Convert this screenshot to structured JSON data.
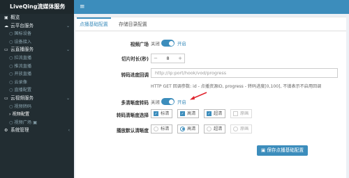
{
  "app": {
    "brand": "LiveQing流媒体服务"
  },
  "sidebar": {
    "items": [
      {
        "icon": "▣",
        "label": "概览",
        "type": "group"
      },
      {
        "icon": "☁",
        "label": "云平台服务",
        "type": "group",
        "caret": "⌄"
      },
      {
        "label": "国标设备",
        "type": "sub"
      },
      {
        "label": "设备接入",
        "type": "sub"
      },
      {
        "icon": "▭",
        "label": "云直播服务",
        "type": "group",
        "caret": "⌄"
      },
      {
        "label": "拉流直播",
        "type": "sub"
      },
      {
        "label": "推流直播",
        "type": "sub"
      },
      {
        "label": "开放直播",
        "type": "sub"
      },
      {
        "label": "云录像",
        "type": "sub"
      },
      {
        "label": "直播配置",
        "type": "sub"
      },
      {
        "icon": "▭",
        "label": "云视频服务",
        "type": "group",
        "caret": "⌄"
      },
      {
        "label": "视频转码",
        "type": "sub"
      },
      {
        "label": "视频配置",
        "type": "sub",
        "active": true
      },
      {
        "label": "视频广场",
        "type": "sub",
        "suffix": "▣"
      },
      {
        "icon": "⚙",
        "label": "系统管理",
        "type": "group",
        "caret": "‹"
      }
    ]
  },
  "topbar": {
    "menu_icon": "≡"
  },
  "tabs": {
    "active": "点播基础配置",
    "other": "存储目录配置"
  },
  "form": {
    "video_square": {
      "label": "视频广场",
      "off": "关闭",
      "on": "开启"
    },
    "slice_duration": {
      "label": "切片时长(秒)",
      "minus": "−",
      "value": "8",
      "plus": "+"
    },
    "transcode_callback": {
      "label": "转码进度回调",
      "placeholder": "http://ip:port/hook/vod/progress",
      "help": "HTTP GET 回调参数: id - 点播资源ID, progress - 转码进度[0,100], 不填表示不启用回调"
    },
    "multi_res": {
      "label": "多清晰度转码",
      "off": "关闭",
      "on": "开启"
    },
    "res_select": {
      "label": "转码清晰度选择",
      "options": [
        {
          "label": "标清",
          "checked": true
        },
        {
          "label": "高清",
          "checked": true
        },
        {
          "label": "超清",
          "checked": true
        },
        {
          "label": "原画",
          "checked": false,
          "disabled": true
        }
      ]
    },
    "default_res": {
      "label": "播放默认清晰度",
      "options": [
        {
          "label": "标清",
          "selected": false
        },
        {
          "label": "高清",
          "selected": true
        },
        {
          "label": "超清",
          "selected": false
        },
        {
          "label": "原画",
          "selected": false,
          "disabled": true
        }
      ]
    },
    "save_button": {
      "icon": "▣",
      "label": "保存点播基础配置"
    }
  },
  "colors": {
    "accent": "#3c8dbc",
    "sidebar": "#222d32",
    "arrow": "#e0242e"
  }
}
